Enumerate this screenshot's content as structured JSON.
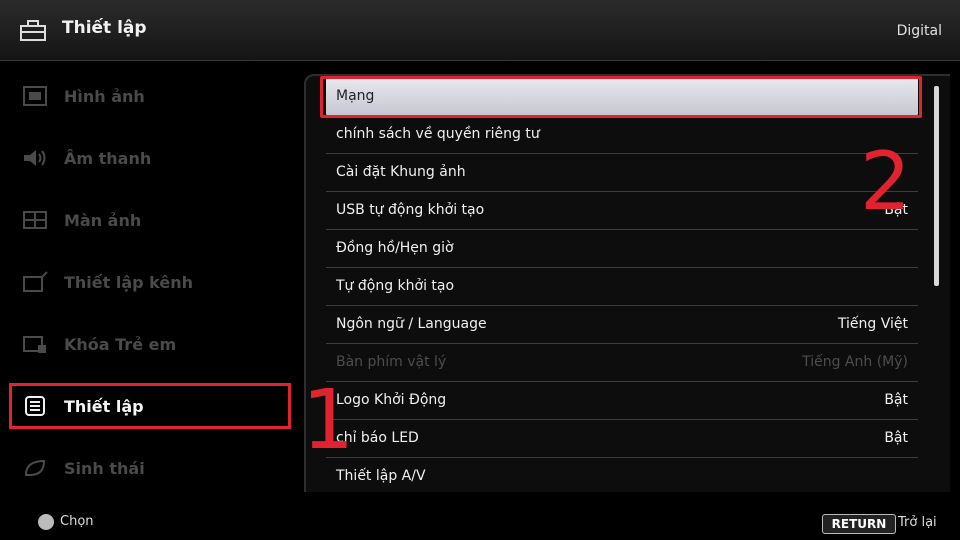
{
  "header": {
    "title": "Thiết lập",
    "source": "Digital"
  },
  "sidebar": {
    "items": [
      {
        "label": "Hình ảnh",
        "icon": "picture-icon"
      },
      {
        "label": "Âm thanh",
        "icon": "speaker-icon"
      },
      {
        "label": "Màn ảnh",
        "icon": "screen-icon"
      },
      {
        "label": "Thiết lập kênh",
        "icon": "channel-setup-icon"
      },
      {
        "label": "Khóa Trẻ em",
        "icon": "child-lock-icon"
      },
      {
        "label": "Thiết lập",
        "icon": "settings-icon",
        "selected": true
      },
      {
        "label": "Sinh thái",
        "icon": "eco-icon"
      }
    ]
  },
  "menu": {
    "items": [
      {
        "label": "Mạng",
        "value": ""
      },
      {
        "label": "chính sách về quyền riêng tư",
        "value": ""
      },
      {
        "label": "Cài đặt Khung ảnh",
        "value": ""
      },
      {
        "label": "USB tự động khởi tạo",
        "value": "Bật"
      },
      {
        "label": "Đồng hồ/Hẹn giờ",
        "value": ""
      },
      {
        "label": "Tự động khởi tạo",
        "value": ""
      },
      {
        "label": "Ngôn ngữ / Language",
        "value": "Tiếng Việt"
      },
      {
        "label": "Bàn phím vật lý",
        "value": "Tiếng Anh (Mỹ)",
        "disabled": true
      },
      {
        "label": "Logo Khởi Động",
        "value": "Bật"
      },
      {
        "label": "chỉ báo LED",
        "value": "Bật"
      },
      {
        "label": "Thiết lập A/V",
        "value": ""
      }
    ]
  },
  "markers": {
    "one": "1",
    "two": "2"
  },
  "footer": {
    "select_label": "Chọn",
    "return_key": "RETURN",
    "return_label": "Trở lại"
  },
  "colors": {
    "highlight": "#e0232e",
    "selection": "#d6d7e0"
  }
}
